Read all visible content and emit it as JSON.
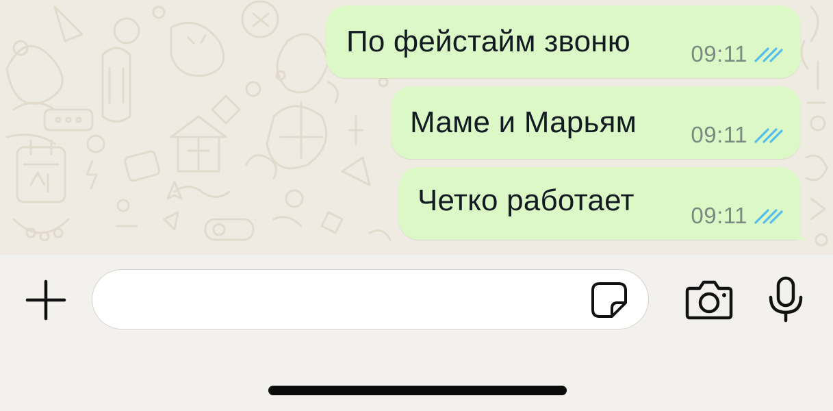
{
  "messages": [
    {
      "text": "По фейстайм звоню",
      "time": "09:11",
      "status": "read",
      "direction": "outgoing"
    },
    {
      "text": "Маме и Марьям",
      "time": "09:11",
      "status": "read",
      "direction": "outgoing"
    },
    {
      "text": "Четко работает",
      "time": "09:11",
      "status": "read",
      "direction": "outgoing"
    }
  ],
  "composer": {
    "input_value": "",
    "input_placeholder": ""
  },
  "icons": {
    "attach": "plus-icon",
    "sticker": "sticker-icon",
    "camera": "camera-icon",
    "voice": "microphone-icon",
    "read_receipt": "double-check-icon"
  },
  "colors": {
    "outgoing_bubble": "#dcf8c6",
    "chat_background": "#efeae2",
    "composer_background": "#f3f1ee",
    "read_ticks": "#53bdeb",
    "timestamp": "#7b8a80",
    "icon": "#111111"
  }
}
